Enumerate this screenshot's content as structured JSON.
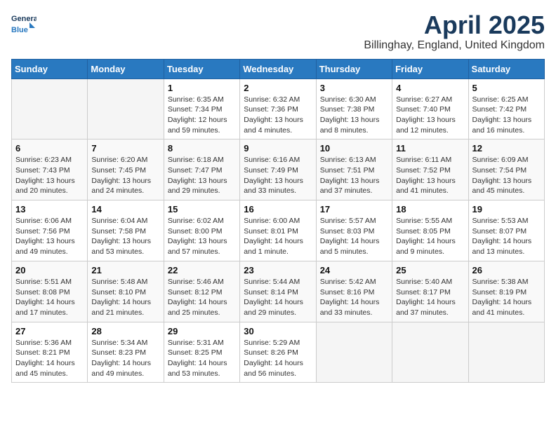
{
  "logo": {
    "general": "General",
    "blue": "Blue"
  },
  "title": "April 2025",
  "location": "Billinghay, England, United Kingdom",
  "days_of_week": [
    "Sunday",
    "Monday",
    "Tuesday",
    "Wednesday",
    "Thursday",
    "Friday",
    "Saturday"
  ],
  "weeks": [
    [
      {
        "day": "",
        "info": ""
      },
      {
        "day": "",
        "info": ""
      },
      {
        "day": "1",
        "info": "Sunrise: 6:35 AM\nSunset: 7:34 PM\nDaylight: 12 hours and 59 minutes."
      },
      {
        "day": "2",
        "info": "Sunrise: 6:32 AM\nSunset: 7:36 PM\nDaylight: 13 hours and 4 minutes."
      },
      {
        "day": "3",
        "info": "Sunrise: 6:30 AM\nSunset: 7:38 PM\nDaylight: 13 hours and 8 minutes."
      },
      {
        "day": "4",
        "info": "Sunrise: 6:27 AM\nSunset: 7:40 PM\nDaylight: 13 hours and 12 minutes."
      },
      {
        "day": "5",
        "info": "Sunrise: 6:25 AM\nSunset: 7:42 PM\nDaylight: 13 hours and 16 minutes."
      }
    ],
    [
      {
        "day": "6",
        "info": "Sunrise: 6:23 AM\nSunset: 7:43 PM\nDaylight: 13 hours and 20 minutes."
      },
      {
        "day": "7",
        "info": "Sunrise: 6:20 AM\nSunset: 7:45 PM\nDaylight: 13 hours and 24 minutes."
      },
      {
        "day": "8",
        "info": "Sunrise: 6:18 AM\nSunset: 7:47 PM\nDaylight: 13 hours and 29 minutes."
      },
      {
        "day": "9",
        "info": "Sunrise: 6:16 AM\nSunset: 7:49 PM\nDaylight: 13 hours and 33 minutes."
      },
      {
        "day": "10",
        "info": "Sunrise: 6:13 AM\nSunset: 7:51 PM\nDaylight: 13 hours and 37 minutes."
      },
      {
        "day": "11",
        "info": "Sunrise: 6:11 AM\nSunset: 7:52 PM\nDaylight: 13 hours and 41 minutes."
      },
      {
        "day": "12",
        "info": "Sunrise: 6:09 AM\nSunset: 7:54 PM\nDaylight: 13 hours and 45 minutes."
      }
    ],
    [
      {
        "day": "13",
        "info": "Sunrise: 6:06 AM\nSunset: 7:56 PM\nDaylight: 13 hours and 49 minutes."
      },
      {
        "day": "14",
        "info": "Sunrise: 6:04 AM\nSunset: 7:58 PM\nDaylight: 13 hours and 53 minutes."
      },
      {
        "day": "15",
        "info": "Sunrise: 6:02 AM\nSunset: 8:00 PM\nDaylight: 13 hours and 57 minutes."
      },
      {
        "day": "16",
        "info": "Sunrise: 6:00 AM\nSunset: 8:01 PM\nDaylight: 14 hours and 1 minute."
      },
      {
        "day": "17",
        "info": "Sunrise: 5:57 AM\nSunset: 8:03 PM\nDaylight: 14 hours and 5 minutes."
      },
      {
        "day": "18",
        "info": "Sunrise: 5:55 AM\nSunset: 8:05 PM\nDaylight: 14 hours and 9 minutes."
      },
      {
        "day": "19",
        "info": "Sunrise: 5:53 AM\nSunset: 8:07 PM\nDaylight: 14 hours and 13 minutes."
      }
    ],
    [
      {
        "day": "20",
        "info": "Sunrise: 5:51 AM\nSunset: 8:08 PM\nDaylight: 14 hours and 17 minutes."
      },
      {
        "day": "21",
        "info": "Sunrise: 5:48 AM\nSunset: 8:10 PM\nDaylight: 14 hours and 21 minutes."
      },
      {
        "day": "22",
        "info": "Sunrise: 5:46 AM\nSunset: 8:12 PM\nDaylight: 14 hours and 25 minutes."
      },
      {
        "day": "23",
        "info": "Sunrise: 5:44 AM\nSunset: 8:14 PM\nDaylight: 14 hours and 29 minutes."
      },
      {
        "day": "24",
        "info": "Sunrise: 5:42 AM\nSunset: 8:16 PM\nDaylight: 14 hours and 33 minutes."
      },
      {
        "day": "25",
        "info": "Sunrise: 5:40 AM\nSunset: 8:17 PM\nDaylight: 14 hours and 37 minutes."
      },
      {
        "day": "26",
        "info": "Sunrise: 5:38 AM\nSunset: 8:19 PM\nDaylight: 14 hours and 41 minutes."
      }
    ],
    [
      {
        "day": "27",
        "info": "Sunrise: 5:36 AM\nSunset: 8:21 PM\nDaylight: 14 hours and 45 minutes."
      },
      {
        "day": "28",
        "info": "Sunrise: 5:34 AM\nSunset: 8:23 PM\nDaylight: 14 hours and 49 minutes."
      },
      {
        "day": "29",
        "info": "Sunrise: 5:31 AM\nSunset: 8:25 PM\nDaylight: 14 hours and 53 minutes."
      },
      {
        "day": "30",
        "info": "Sunrise: 5:29 AM\nSunset: 8:26 PM\nDaylight: 14 hours and 56 minutes."
      },
      {
        "day": "",
        "info": ""
      },
      {
        "day": "",
        "info": ""
      },
      {
        "day": "",
        "info": ""
      }
    ]
  ]
}
